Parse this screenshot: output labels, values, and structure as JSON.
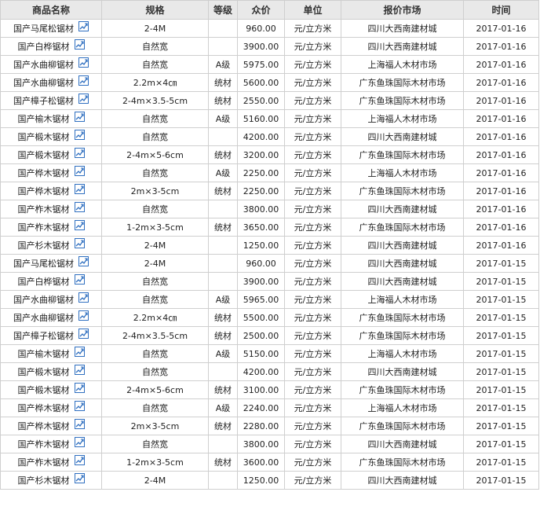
{
  "table": {
    "headers": [
      "商品名称",
      "规格",
      "等级",
      "众价",
      "单位",
      "报价市场",
      "时间"
    ],
    "rows": [
      {
        "name": "国产马尾松锯材",
        "spec": "2-4M",
        "grade": "",
        "price": "960.00",
        "unit": "元/立方米",
        "market": "四川大西南建材城",
        "date": "2017-01-16"
      },
      {
        "name": "国产白桦锯材",
        "spec": "自然宽",
        "grade": "",
        "price": "3900.00",
        "unit": "元/立方米",
        "market": "四川大西南建材城",
        "date": "2017-01-16"
      },
      {
        "name": "国产水曲柳锯材",
        "spec": "自然宽",
        "grade": "A级",
        "price": "5975.00",
        "unit": "元/立方米",
        "market": "上海福人木材市场",
        "date": "2017-01-16"
      },
      {
        "name": "国产水曲柳锯材",
        "spec": "2.2m×4㎝",
        "grade": "统材",
        "price": "5600.00",
        "unit": "元/立方米",
        "market": "广东鱼珠国际木材市场",
        "date": "2017-01-16"
      },
      {
        "name": "国产樟子松锯材",
        "spec": "2-4m×3.5-5cm",
        "grade": "统材",
        "price": "2550.00",
        "unit": "元/立方米",
        "market": "广东鱼珠国际木材市场",
        "date": "2017-01-16"
      },
      {
        "name": "国产榆木锯材",
        "spec": "自然宽",
        "grade": "A级",
        "price": "5160.00",
        "unit": "元/立方米",
        "market": "上海福人木材市场",
        "date": "2017-01-16"
      },
      {
        "name": "国产椴木锯材",
        "spec": "自然宽",
        "grade": "",
        "price": "4200.00",
        "unit": "元/立方米",
        "market": "四川大西南建材城",
        "date": "2017-01-16"
      },
      {
        "name": "国产椴木锯材",
        "spec": "2-4m×5-6cm",
        "grade": "统材",
        "price": "3200.00",
        "unit": "元/立方米",
        "market": "广东鱼珠国际木材市场",
        "date": "2017-01-16"
      },
      {
        "name": "国产桦木锯材",
        "spec": "自然宽",
        "grade": "A级",
        "price": "2250.00",
        "unit": "元/立方米",
        "market": "上海福人木材市场",
        "date": "2017-01-16"
      },
      {
        "name": "国产桦木锯材",
        "spec": "2m×3-5cm",
        "grade": "统材",
        "price": "2250.00",
        "unit": "元/立方米",
        "market": "广东鱼珠国际木材市场",
        "date": "2017-01-16"
      },
      {
        "name": "国产柞木锯材",
        "spec": "自然宽",
        "grade": "",
        "price": "3800.00",
        "unit": "元/立方米",
        "market": "四川大西南建材城",
        "date": "2017-01-16"
      },
      {
        "name": "国产柞木锯材",
        "spec": "1-2m×3-5cm",
        "grade": "统材",
        "price": "3650.00",
        "unit": "元/立方米",
        "market": "广东鱼珠国际木材市场",
        "date": "2017-01-16"
      },
      {
        "name": "国产杉木锯材",
        "spec": "2-4M",
        "grade": "",
        "price": "1250.00",
        "unit": "元/立方米",
        "market": "四川大西南建材城",
        "date": "2017-01-16"
      },
      {
        "name": "国产马尾松锯材",
        "spec": "2-4M",
        "grade": "",
        "price": "960.00",
        "unit": "元/立方米",
        "market": "四川大西南建材城",
        "date": "2017-01-15"
      },
      {
        "name": "国产白桦锯材",
        "spec": "自然宽",
        "grade": "",
        "price": "3900.00",
        "unit": "元/立方米",
        "market": "四川大西南建材城",
        "date": "2017-01-15"
      },
      {
        "name": "国产水曲柳锯材",
        "spec": "自然宽",
        "grade": "A级",
        "price": "5965.00",
        "unit": "元/立方米",
        "market": "上海福人木材市场",
        "date": "2017-01-15"
      },
      {
        "name": "国产水曲柳锯材",
        "spec": "2.2m×4㎝",
        "grade": "统材",
        "price": "5500.00",
        "unit": "元/立方米",
        "market": "广东鱼珠国际木材市场",
        "date": "2017-01-15"
      },
      {
        "name": "国产樟子松锯材",
        "spec": "2-4m×3.5-5cm",
        "grade": "统材",
        "price": "2500.00",
        "unit": "元/立方米",
        "market": "广东鱼珠国际木材市场",
        "date": "2017-01-15"
      },
      {
        "name": "国产榆木锯材",
        "spec": "自然宽",
        "grade": "A级",
        "price": "5150.00",
        "unit": "元/立方米",
        "market": "上海福人木材市场",
        "date": "2017-01-15"
      },
      {
        "name": "国产椴木锯材",
        "spec": "自然宽",
        "grade": "",
        "price": "4200.00",
        "unit": "元/立方米",
        "market": "四川大西南建材城",
        "date": "2017-01-15"
      },
      {
        "name": "国产椴木锯材",
        "spec": "2-4m×5-6cm",
        "grade": "统材",
        "price": "3100.00",
        "unit": "元/立方米",
        "market": "广东鱼珠国际木材市场",
        "date": "2017-01-15"
      },
      {
        "name": "国产桦木锯材",
        "spec": "自然宽",
        "grade": "A级",
        "price": "2240.00",
        "unit": "元/立方米",
        "market": "上海福人木材市场",
        "date": "2017-01-15"
      },
      {
        "name": "国产桦木锯材",
        "spec": "2m×3-5cm",
        "grade": "统材",
        "price": "2280.00",
        "unit": "元/立方米",
        "market": "广东鱼珠国际木材市场",
        "date": "2017-01-15"
      },
      {
        "name": "国产柞木锯材",
        "spec": "自然宽",
        "grade": "",
        "price": "3800.00",
        "unit": "元/立方米",
        "market": "四川大西南建材城",
        "date": "2017-01-15"
      },
      {
        "name": "国产柞木锯材",
        "spec": "1-2m×3-5cm",
        "grade": "统材",
        "price": "3600.00",
        "unit": "元/立方米",
        "market": "广东鱼珠国际木材市场",
        "date": "2017-01-15"
      },
      {
        "name": "国产杉木锯材",
        "spec": "2-4M",
        "grade": "",
        "price": "1250.00",
        "unit": "元/立方米",
        "market": "四川大西南建材城",
        "date": "2017-01-15"
      }
    ]
  },
  "icons": {
    "chart": "trend-chart-icon"
  },
  "colors": {
    "header_bg": "#e9e9e9",
    "border": "#cfcfcf",
    "icon_blue": "#2f6fc0"
  }
}
